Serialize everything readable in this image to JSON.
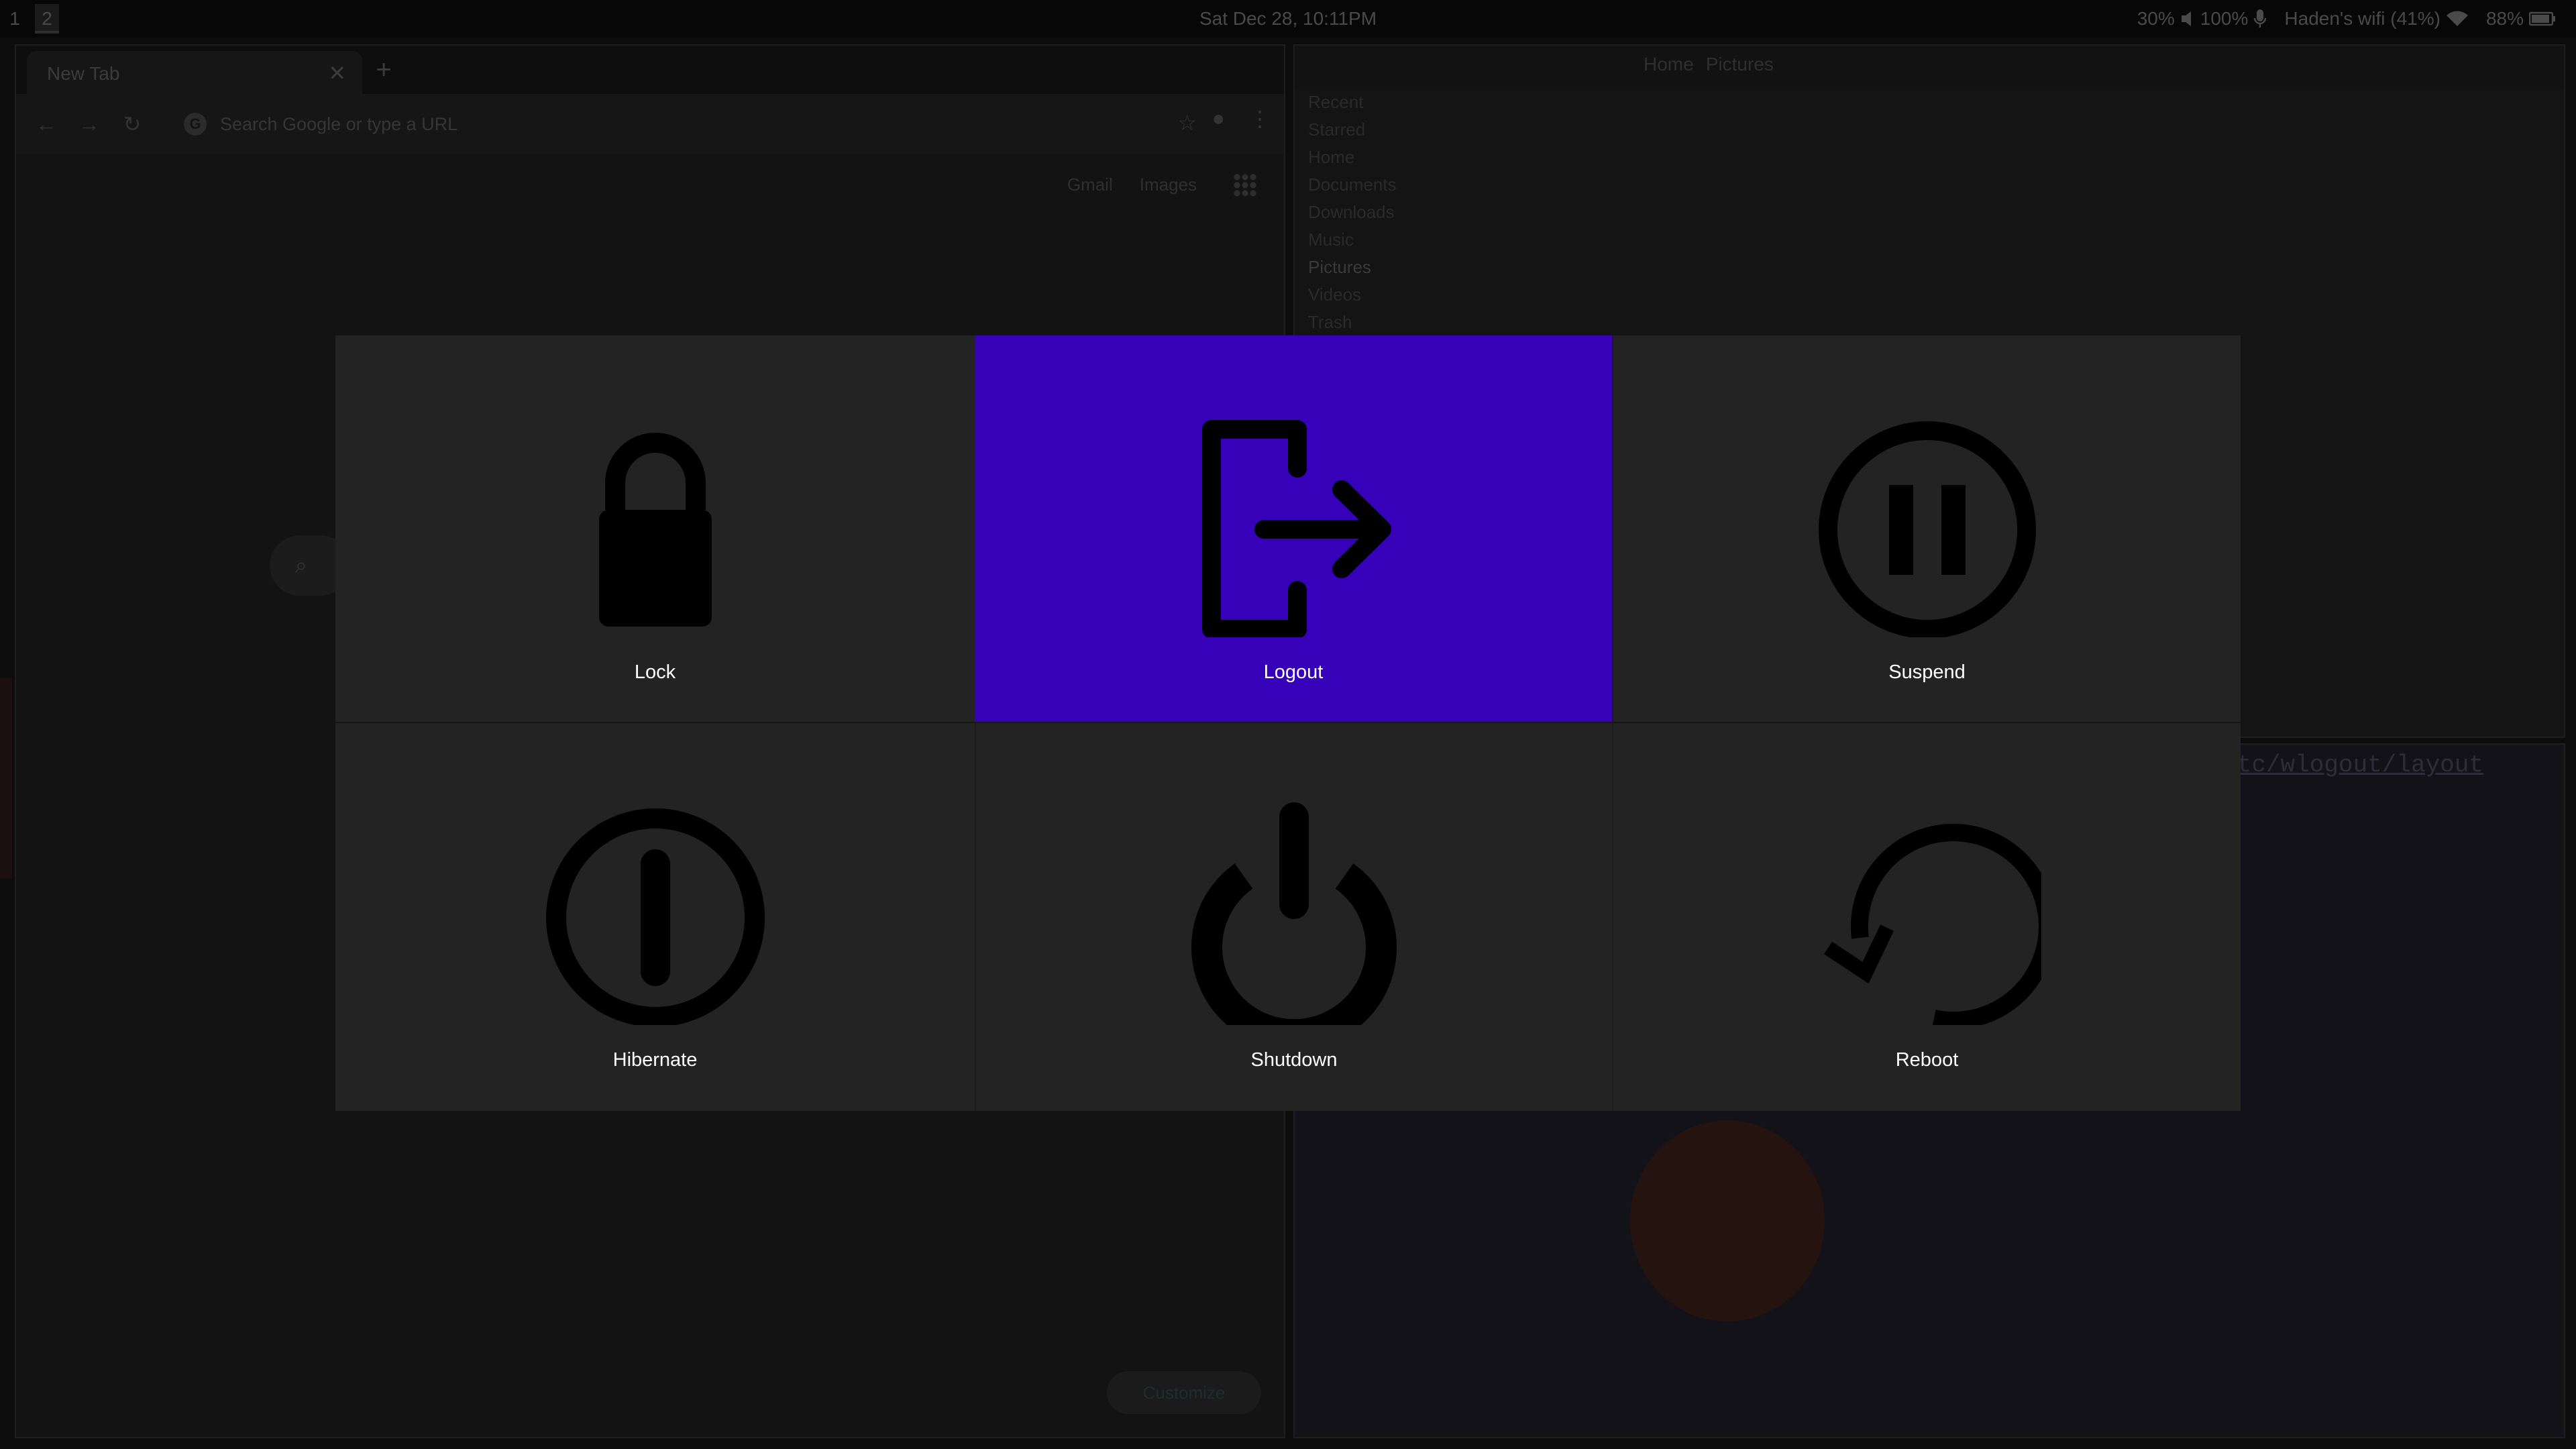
{
  "statusbar": {
    "workspaces": [
      "1",
      "2"
    ],
    "clock": "Sat Dec 28, 10:11PM",
    "volume": "30%",
    "mic": "100%",
    "wifi": "Haden's wifi (41%)",
    "battery": "88%"
  },
  "browser": {
    "tab_title": "New Tab",
    "tab_close": "✕",
    "new_tab": "+",
    "omnibox_placeholder": "Search Google or type a URL",
    "links": [
      "Gmail",
      "Images"
    ],
    "customize_label": "Customize"
  },
  "files": {
    "path": [
      "Home",
      "Pictures"
    ],
    "sidebar": [
      "Recent",
      "Starred",
      "Home",
      "Documents",
      "Downloads",
      "Music",
      "Pictures",
      "Videos",
      "Trash"
    ],
    "selected": "Pictures"
  },
  "terminal": {
    "link_text": "tc/wlogout/layout"
  },
  "wlogout": {
    "accent_color": "#3700b9",
    "buttons": [
      {
        "label": "Lock",
        "icon": "lock-icon"
      },
      {
        "label": "Logout",
        "icon": "logout-icon",
        "active": true
      },
      {
        "label": "Suspend",
        "icon": "suspend-icon"
      },
      {
        "label": "Hibernate",
        "icon": "hibernate-icon"
      },
      {
        "label": "Shutdown",
        "icon": "power-icon"
      },
      {
        "label": "Reboot",
        "icon": "reboot-icon"
      }
    ]
  }
}
